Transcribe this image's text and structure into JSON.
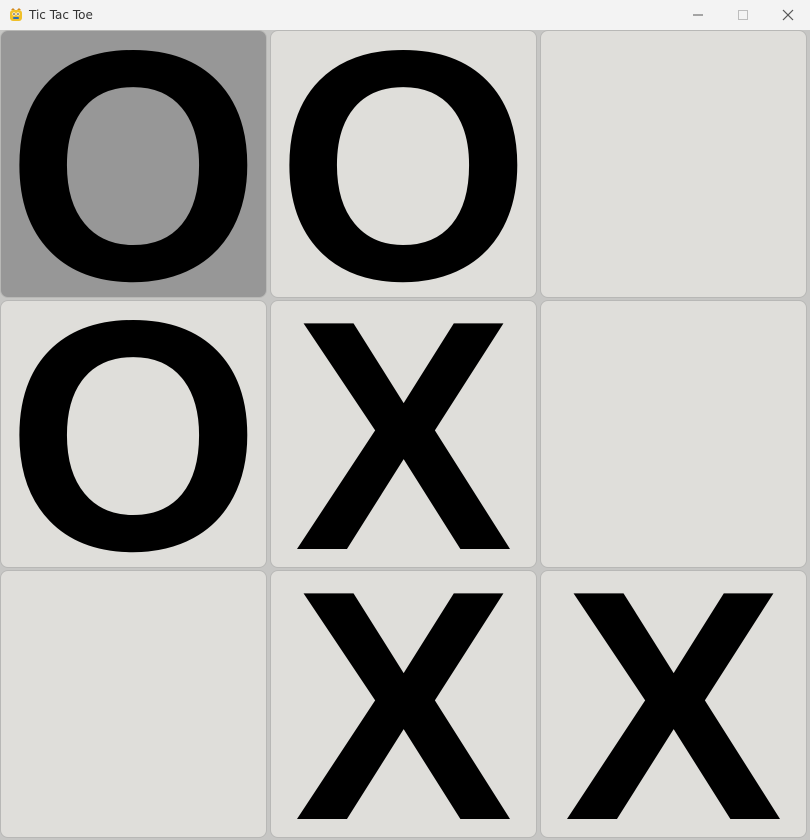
{
  "window": {
    "title": "Tic Tac Toe",
    "app_icon": "pygame-snake-icon",
    "controls": [
      "minimize-icon",
      "maximize-icon",
      "close-icon"
    ]
  },
  "board": {
    "selected_cell": "0",
    "cells": [
      "O",
      "O",
      "",
      "O",
      "X",
      "",
      "",
      "X",
      "X"
    ]
  },
  "colors": {
    "cell_background": "#dfdeda",
    "selected_background": "#979797",
    "grid_gap": "#c6c6c4",
    "mark": "#000000"
  }
}
